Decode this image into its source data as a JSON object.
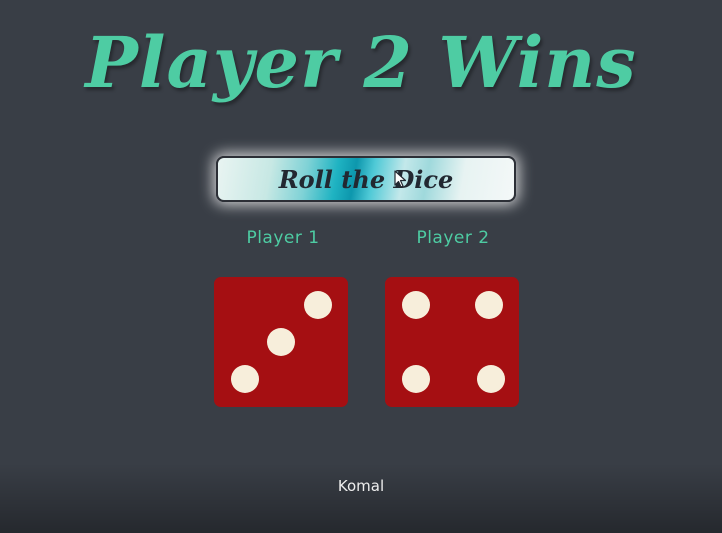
{
  "title": "Player 2 Wins",
  "roll_button": {
    "label": "Roll the Dice"
  },
  "players": [
    {
      "label": "Player 1",
      "die_value": 3
    },
    {
      "label": "Player 2",
      "die_value": 4
    }
  ],
  "footer": {
    "author": "Komal"
  },
  "colors": {
    "background": "#393e46",
    "accent": "#4ecca3",
    "die": "#a50f12",
    "pip": "#f7eedb"
  },
  "icons": {
    "cursor": "cursor-arrow-icon"
  }
}
